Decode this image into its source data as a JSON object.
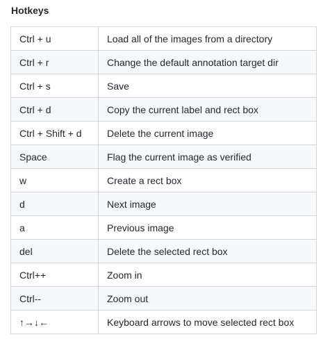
{
  "heading": "Hotkeys",
  "rows": [
    {
      "key": "Ctrl + u",
      "description": "Load all of the images from a directory"
    },
    {
      "key": "Ctrl + r",
      "description": "Change the default annotation target dir"
    },
    {
      "key": "Ctrl + s",
      "description": "Save"
    },
    {
      "key": "Ctrl + d",
      "description": "Copy the current label and rect box"
    },
    {
      "key": "Ctrl + Shift + d",
      "description": "Delete the current image"
    },
    {
      "key": "Space",
      "description": "Flag the current image as verified"
    },
    {
      "key": "w",
      "description": "Create a rect box"
    },
    {
      "key": "d",
      "description": "Next image"
    },
    {
      "key": "a",
      "description": "Previous image"
    },
    {
      "key": "del",
      "description": "Delete the selected rect box"
    },
    {
      "key": "Ctrl++",
      "description": "Zoom in"
    },
    {
      "key": "Ctrl--",
      "description": "Zoom out"
    },
    {
      "key": "↑→↓←",
      "description": "Keyboard arrows to move selected rect box"
    }
  ]
}
